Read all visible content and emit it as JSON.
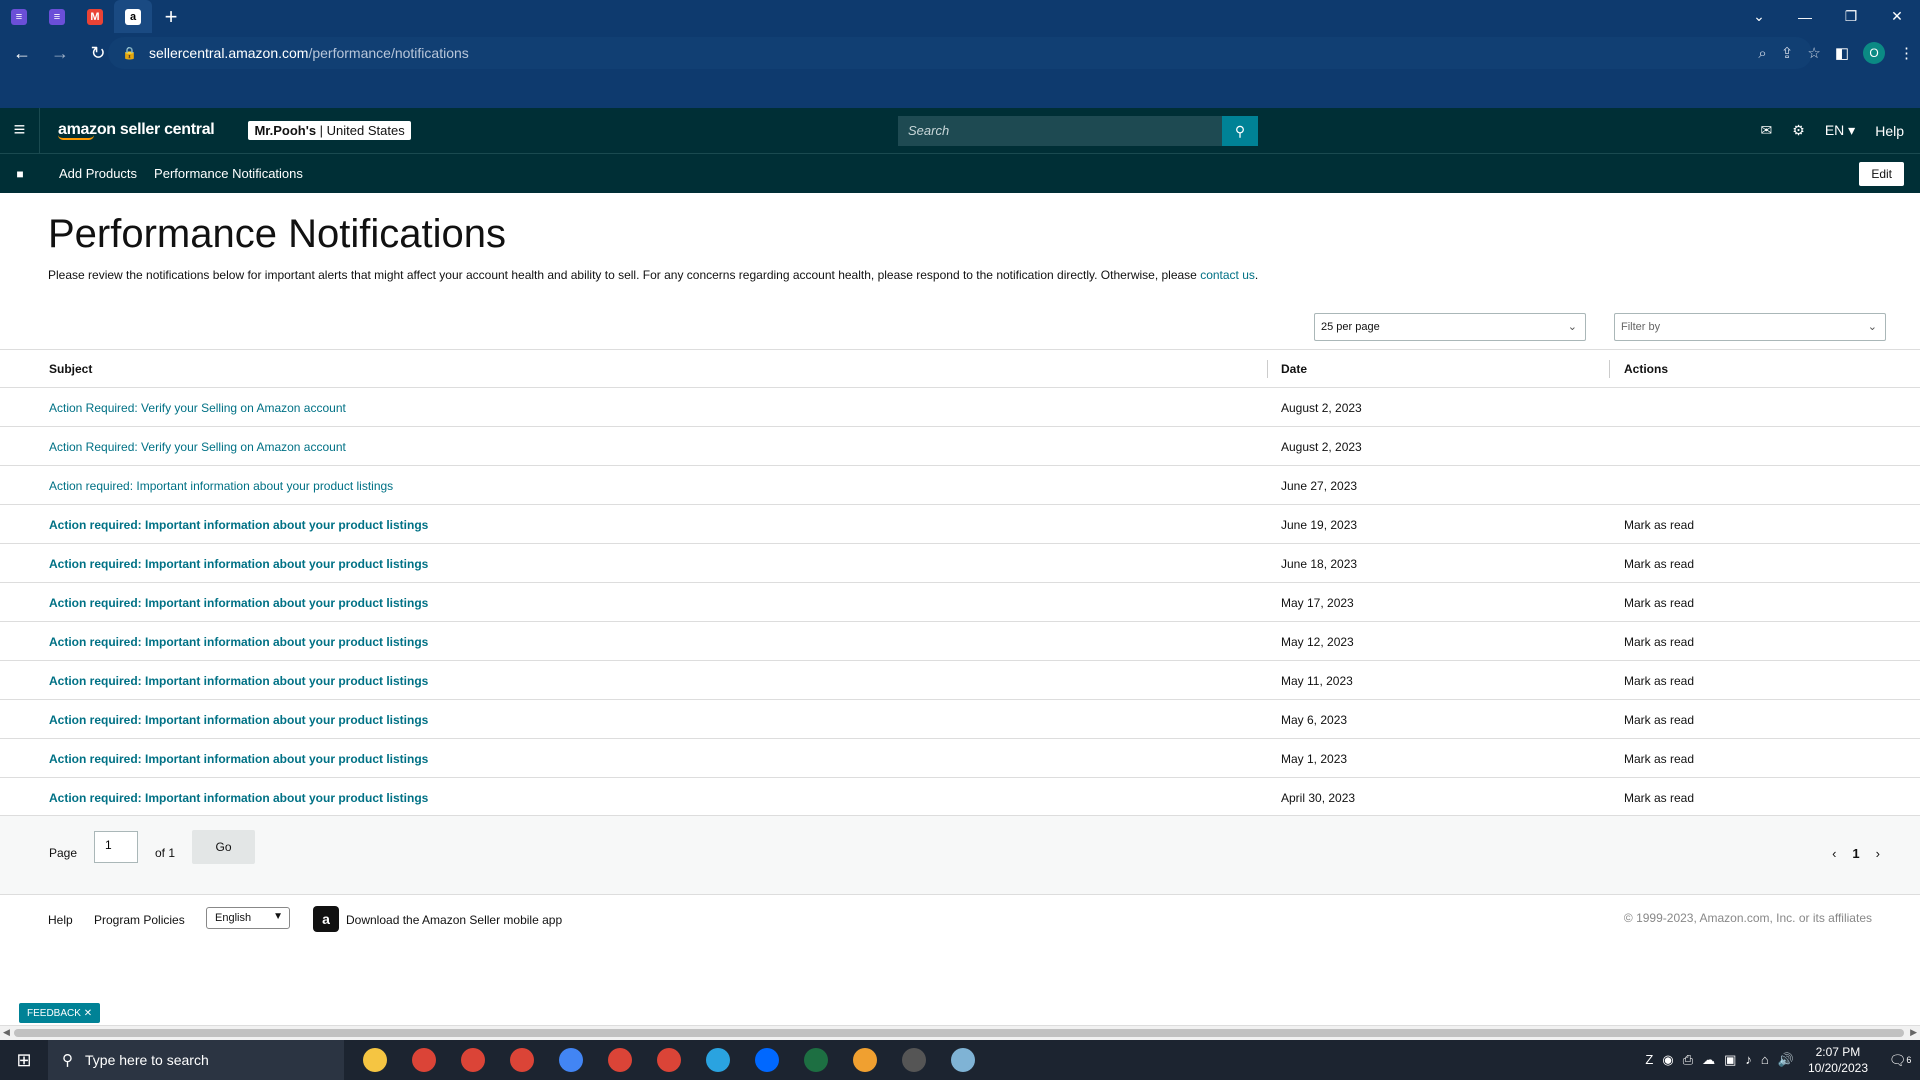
{
  "browser": {
    "tabs": [
      {
        "icon": "purple-doc-icon",
        "color": "#6b4fd8"
      },
      {
        "icon": "purple-doc-icon",
        "color": "#6b4fd8"
      },
      {
        "icon": "gmail-icon",
        "color": "#ea4335"
      },
      {
        "icon": "amazon-icon",
        "color": "#000000",
        "active": true
      }
    ],
    "url_host": "sellercentral.amazon.com",
    "url_path": "/performance/notifications",
    "profile_initial": "O"
  },
  "header": {
    "logo_text": "amazon seller central",
    "store_name": "Mr.Pooh's",
    "store_region": "United States",
    "search_placeholder": "Search",
    "language": "EN",
    "help": "Help"
  },
  "bookmarks": {
    "items": [
      "Add Products",
      "Performance Notifications"
    ],
    "edit_label": "Edit"
  },
  "main": {
    "title": "Performance Notifications",
    "intro_text": "Please review the notifications below for important alerts that might affect your account health and ability to sell. For any concerns regarding account health, please respond to the notification directly. Otherwise, please ",
    "intro_link": "contact us",
    "intro_end": ".",
    "per_page": "25 per page",
    "filter_placeholder": "Filter by",
    "columns": {
      "subject": "Subject",
      "date": "Date",
      "actions": "Actions"
    },
    "rows": [
      {
        "subject": "Action Required: Verify your Selling on Amazon account",
        "date": "August 2, 2023",
        "action": "",
        "unread": false
      },
      {
        "subject": "Action Required: Verify your Selling on Amazon account",
        "date": "August 2, 2023",
        "action": "",
        "unread": false
      },
      {
        "subject": "Action required: Important information about your product listings",
        "date": "June 27, 2023",
        "action": "",
        "unread": false
      },
      {
        "subject": "Action required: Important information about your product listings",
        "date": "June 19, 2023",
        "action": "Mark as read",
        "unread": true
      },
      {
        "subject": "Action required: Important information about your product listings",
        "date": "June 18, 2023",
        "action": "Mark as read",
        "unread": true
      },
      {
        "subject": "Action required: Important information about your product listings",
        "date": "May 17, 2023",
        "action": "Mark as read",
        "unread": true
      },
      {
        "subject": "Action required: Important information about your product listings",
        "date": "May 12, 2023",
        "action": "Mark as read",
        "unread": true
      },
      {
        "subject": "Action required: Important information about your product listings",
        "date": "May 11, 2023",
        "action": "Mark as read",
        "unread": true
      },
      {
        "subject": "Action required: Important information about your product listings",
        "date": "May 6, 2023",
        "action": "Mark as read",
        "unread": true
      },
      {
        "subject": "Action required: Important information about your product listings",
        "date": "May 1, 2023",
        "action": "Mark as read",
        "unread": true
      },
      {
        "subject": "Action required: Important information about your product listings",
        "date": "April 30, 2023",
        "action": "Mark as read",
        "unread": true
      }
    ],
    "pager": {
      "label": "Page",
      "value": "1",
      "of": "of 1",
      "go": "Go",
      "current": "1"
    }
  },
  "footer": {
    "help": "Help",
    "policies": "Program Policies",
    "language": "English",
    "app_text": "Download the Amazon Seller mobile app",
    "copyright": "© 1999-2023, Amazon.com, Inc. or its affiliates"
  },
  "feedback": "FEEDBACK",
  "taskbar": {
    "search_placeholder": "Type here to search",
    "time": "2:07 PM",
    "date": "10/20/2023",
    "notif_count": "6",
    "apps": [
      {
        "icon": "file-explorer-icon",
        "color": "#f5c542"
      },
      {
        "icon": "chrome-icon",
        "color": "#db4437"
      },
      {
        "icon": "chrome-icon",
        "color": "#db4437"
      },
      {
        "icon": "chrome-icon",
        "color": "#db4437"
      },
      {
        "icon": "chrome-icon",
        "color": "#4285f4"
      },
      {
        "icon": "chrome-icon",
        "color": "#db4437"
      },
      {
        "icon": "chrome-icon",
        "color": "#db4437"
      },
      {
        "icon": "telegram-icon",
        "color": "#2aa3e0"
      },
      {
        "icon": "zalo-icon",
        "color": "#0068ff"
      },
      {
        "icon": "excel-icon",
        "color": "#1d6f42"
      },
      {
        "icon": "app-icon",
        "color": "#f0a030"
      },
      {
        "icon": "calculator-icon",
        "color": "#555555"
      },
      {
        "icon": "notepad-icon",
        "color": "#7fb3d5"
      }
    ]
  }
}
